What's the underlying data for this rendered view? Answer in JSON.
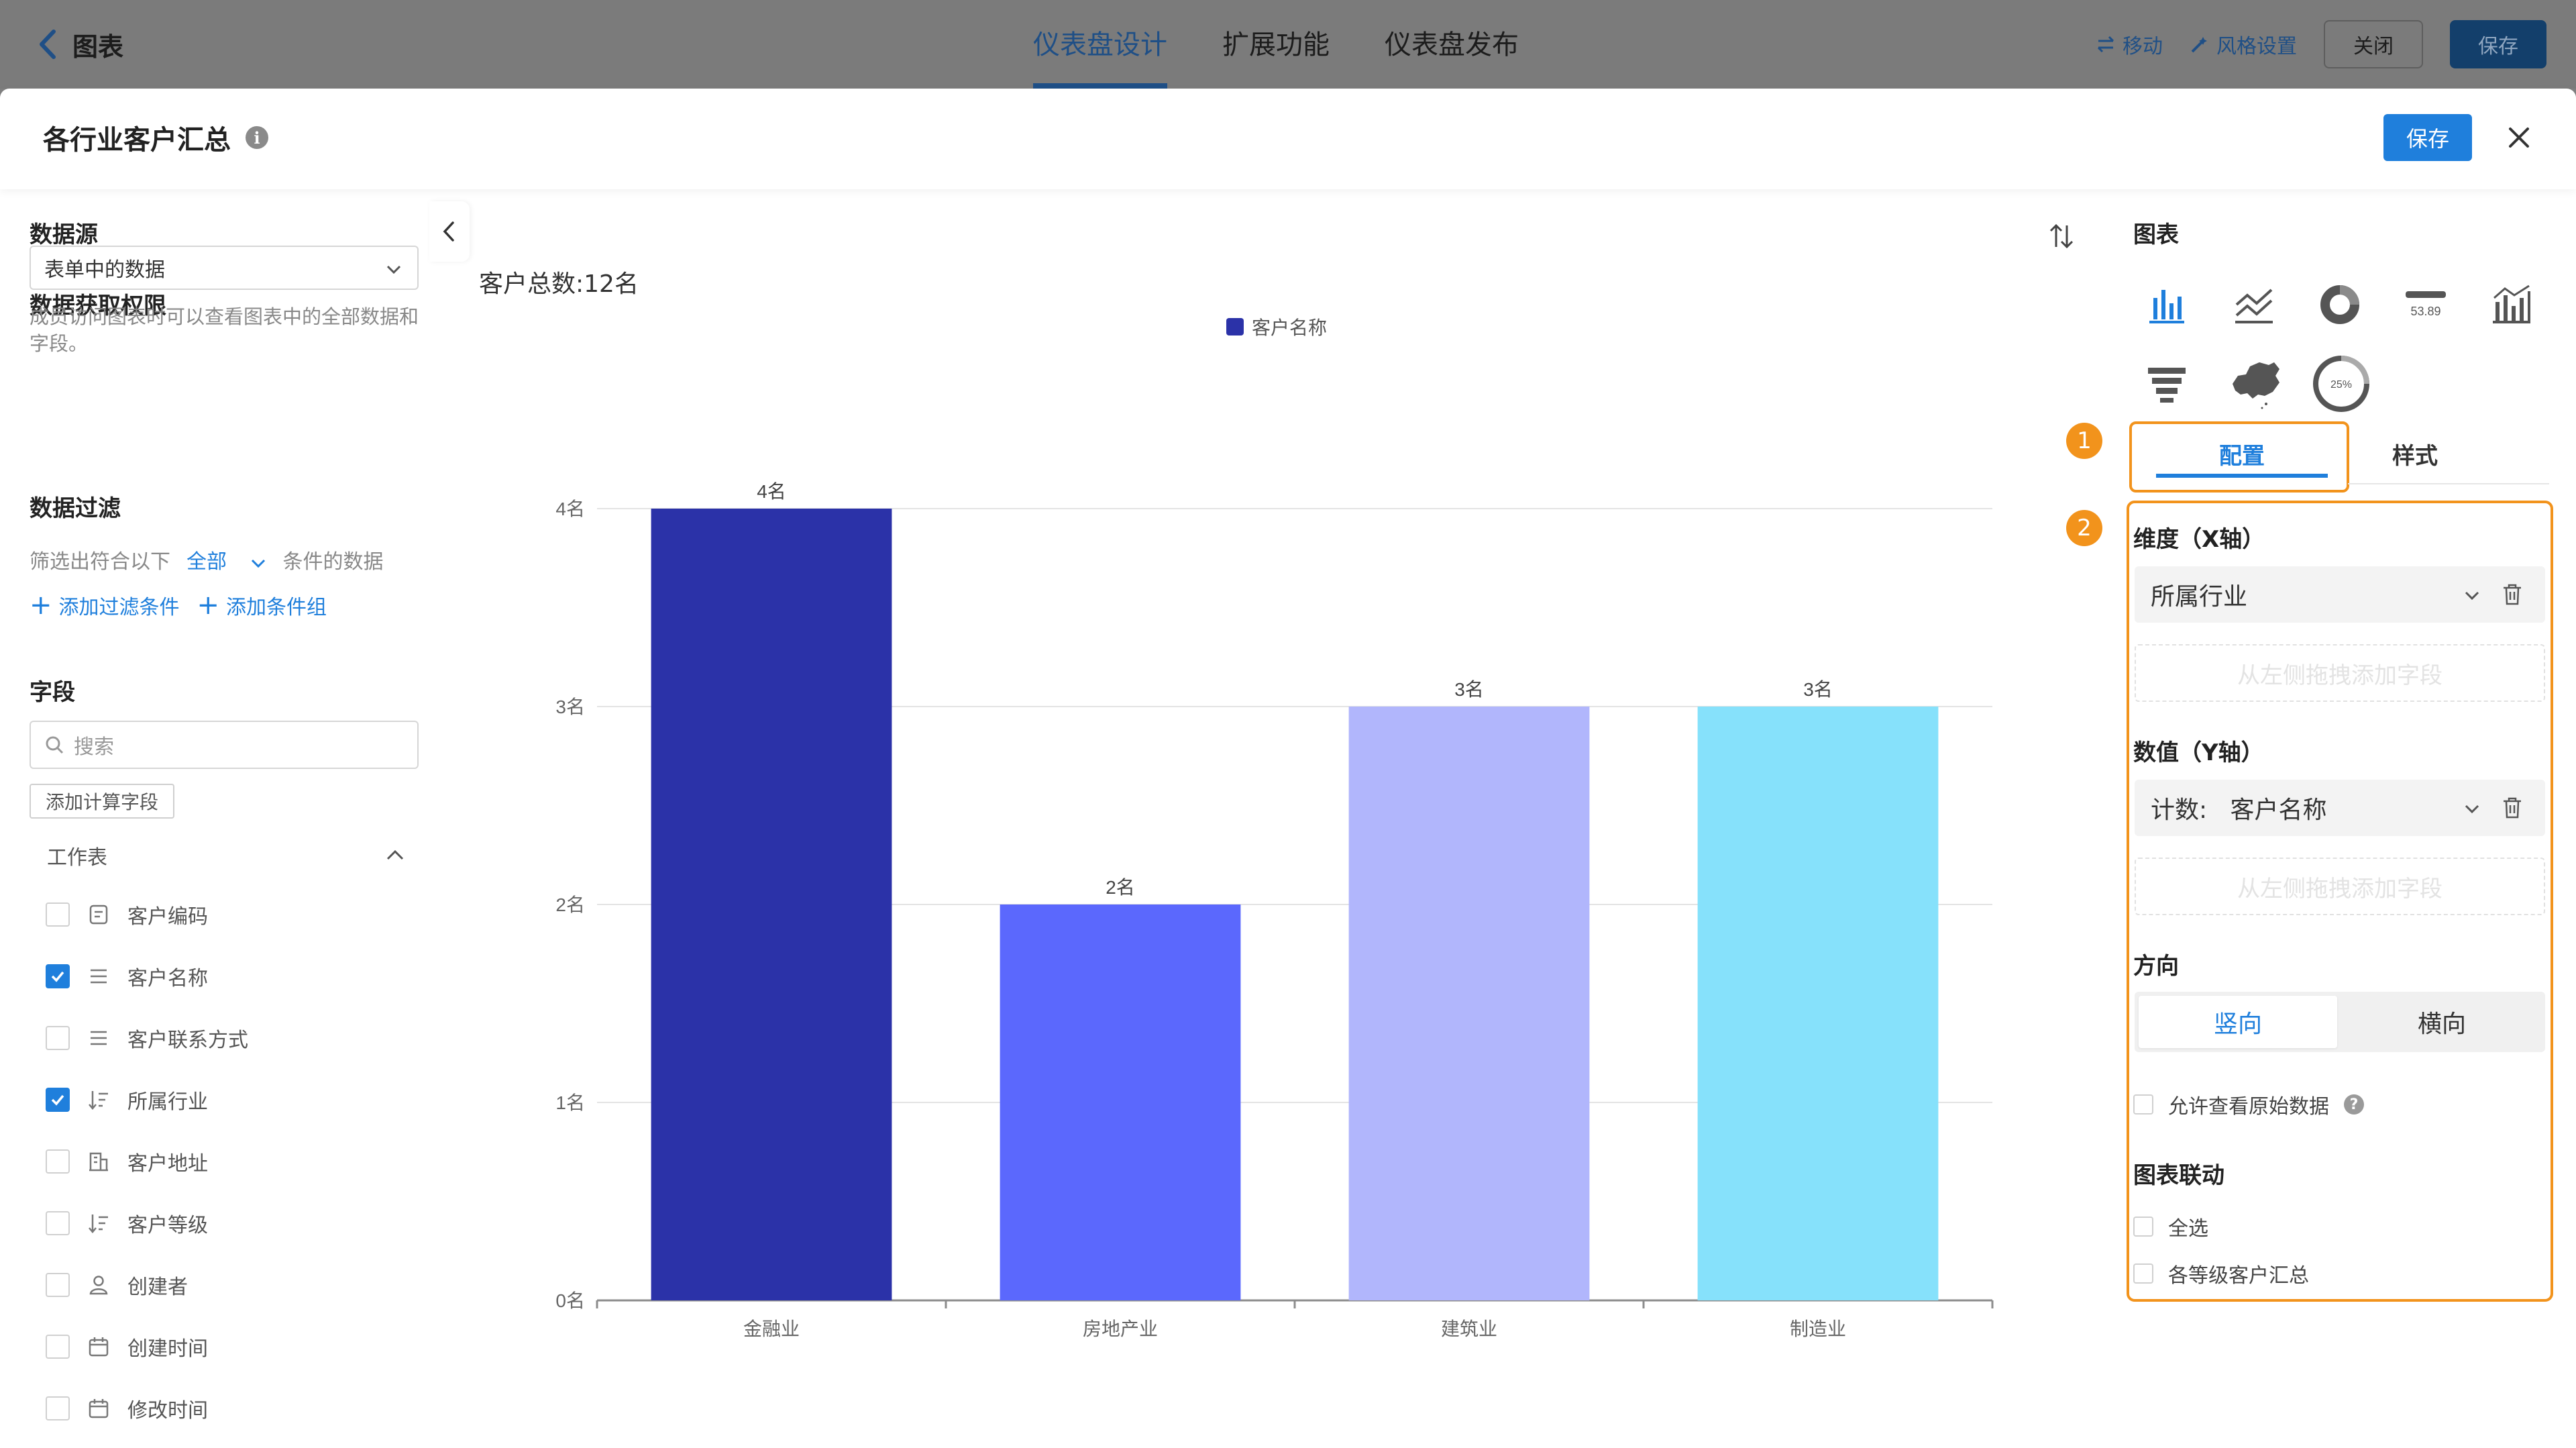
{
  "app": {
    "back_label": "图表",
    "nav_tabs": [
      {
        "label": "仪表盘设计",
        "active": true
      },
      {
        "label": "扩展功能",
        "active": false
      },
      {
        "label": "仪表盘发布",
        "active": false
      }
    ],
    "move_label": "移动",
    "style_settings_label": "风格设置",
    "close_label": "关闭",
    "save_label": "保存"
  },
  "modal": {
    "title": "各行业客户汇总",
    "info_glyph": "i",
    "save_label": "保存"
  },
  "left": {
    "datasource_title": "数据源",
    "permission_title": "数据获取权限",
    "permission_value": "表单中的数据",
    "permission_hint": "成员访问图表时可以查看图表中的全部数据和字段。",
    "filter_title": "数据过滤",
    "filter_prefix": "筛选出符合以下",
    "filter_mode": "全部",
    "filter_suffix": "条件的数据",
    "add_filter": "添加过滤条件",
    "add_group": "添加条件组",
    "fields_title": "字段",
    "search_placeholder": "搜索",
    "add_calc_field": "添加计算字段",
    "worksheet_label": "工作表",
    "fields": [
      {
        "label": "客户编码",
        "checked": false,
        "icon": "id-card-icon"
      },
      {
        "label": "客户名称",
        "checked": true,
        "icon": "text-lines-icon"
      },
      {
        "label": "客户联系方式",
        "checked": false,
        "icon": "text-lines-icon"
      },
      {
        "label": "所属行业",
        "checked": true,
        "icon": "sort-list-icon"
      },
      {
        "label": "客户地址",
        "checked": false,
        "icon": "building-icon"
      },
      {
        "label": "客户等级",
        "checked": false,
        "icon": "sort-list-icon"
      },
      {
        "label": "创建者",
        "checked": false,
        "icon": "user-icon"
      },
      {
        "label": "创建时间",
        "checked": false,
        "icon": "calendar-icon"
      },
      {
        "label": "修改时间",
        "checked": false,
        "icon": "calendar-icon"
      }
    ]
  },
  "chart_header": {
    "total_text": "客户总数:12名"
  },
  "chart_data": {
    "type": "bar",
    "title": "",
    "categories": [
      "金融业",
      "房地产业",
      "建筑业",
      "制造业"
    ],
    "series": [
      {
        "name": "客户名称",
        "values": [
          4,
          2,
          3,
          3
        ]
      }
    ],
    "bar_colors": [
      "#2b32a8",
      "#5b68fd",
      "#b1b6fc",
      "#86e1fb"
    ],
    "legend_color": "#2b32a8",
    "data_labels": [
      "4名",
      "2名",
      "3名",
      "3名"
    ],
    "y_ticks": [
      "0名",
      "1名",
      "2名",
      "3名",
      "4名"
    ],
    "ylim": [
      0,
      4
    ],
    "grid": true,
    "legend_position": "top-center"
  },
  "right": {
    "chart_section_title": "图表",
    "chart_types": [
      "bar-chart-icon",
      "line-chart-icon",
      "donut-chart-icon",
      "number-card-icon",
      "combo-chart-icon",
      "funnel-chart-icon",
      "china-map-icon",
      "progress-ring-icon"
    ],
    "number_card_value": "53.89",
    "progress_ring_value": "25%",
    "step_badges": [
      "1",
      "2"
    ],
    "tabs": {
      "config": "配置",
      "style": "样式"
    },
    "dimension_label": "维度（X轴）",
    "dimension_field": "所属行业",
    "drop_hint": "从左侧拖拽添加字段",
    "value_label": "数值（Y轴）",
    "value_field": "计数:   客户名称",
    "direction_label": "方向",
    "direction_vertical": "竖向",
    "direction_horizontal": "横向",
    "allow_raw_label": "允许查看原始数据",
    "help_glyph": "?",
    "linkage_title": "图表联动",
    "select_all": "全选",
    "linkage_option": "各等级客户汇总"
  },
  "colors": {
    "accent": "#1f7fdc",
    "highlight": "#f2931c"
  }
}
